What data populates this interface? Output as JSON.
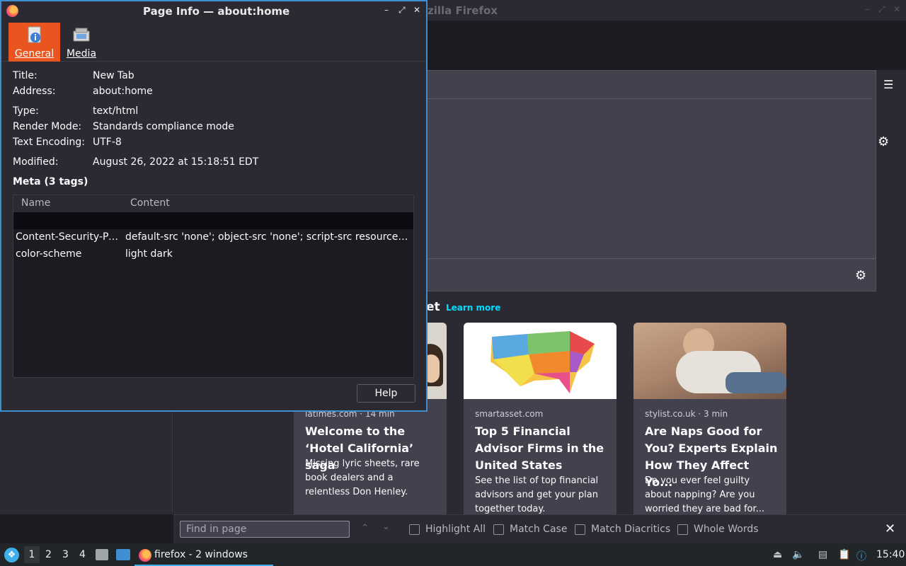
{
  "firefox": {
    "title_fragment": "zilla Firefox",
    "pocket_heading_fragment": "et",
    "learn_more": "Learn more",
    "cards": [
      {
        "source": "latimes.com · 14 min",
        "title": "Welcome to the ‘Hotel California’ saga",
        "description": "Missing lyric sheets, rare book dealers and a relentless Don Henley."
      },
      {
        "source": "smartasset.com",
        "title": "Top 5 Financial Advisor Firms in the United States",
        "description": "See the list of top financial advisors and get your plan together today."
      },
      {
        "source": "stylist.co.uk · 3 min",
        "title": "Are Naps Good for You? Experts Explain How They Affect Yo...",
        "description": "Do you ever feel guilty about napping? Are you worried they are bad for..."
      }
    ]
  },
  "findbar": {
    "placeholder": "Find in page",
    "options": [
      "Highlight All",
      "Match Case",
      "Match Diacritics",
      "Whole Words"
    ]
  },
  "taskbar": {
    "workspaces": [
      "1",
      "2",
      "3",
      "4"
    ],
    "task_label": "firefox - 2 windows",
    "clock": "15:40"
  },
  "dialog": {
    "title": "Page Info — about:home",
    "tabs": {
      "general": "General",
      "media": "Media"
    },
    "fields": {
      "title_label": "Title:",
      "title_value": "New Tab",
      "address_label": "Address:",
      "address_value": "about:home",
      "type_label": "Type:",
      "type_value": "text/html",
      "render_label": "Render Mode:",
      "render_value": "Standards compliance mode",
      "encoding_label": "Text Encoding:",
      "encoding_value": "UTF-8",
      "modified_label": "Modified:",
      "modified_value": "August 26, 2022 at 15:18:51 EDT"
    },
    "meta_heading": "Meta (3 tags)",
    "meta_columns": {
      "name": "Name",
      "content": "Content"
    },
    "meta_rows": [
      {
        "name": "Content-Security-Pol...",
        "content": "default-src 'none'; object-src 'none'; script-src resource: c..."
      },
      {
        "name": "color-scheme",
        "content": "light dark"
      }
    ],
    "help_label": "Help"
  }
}
